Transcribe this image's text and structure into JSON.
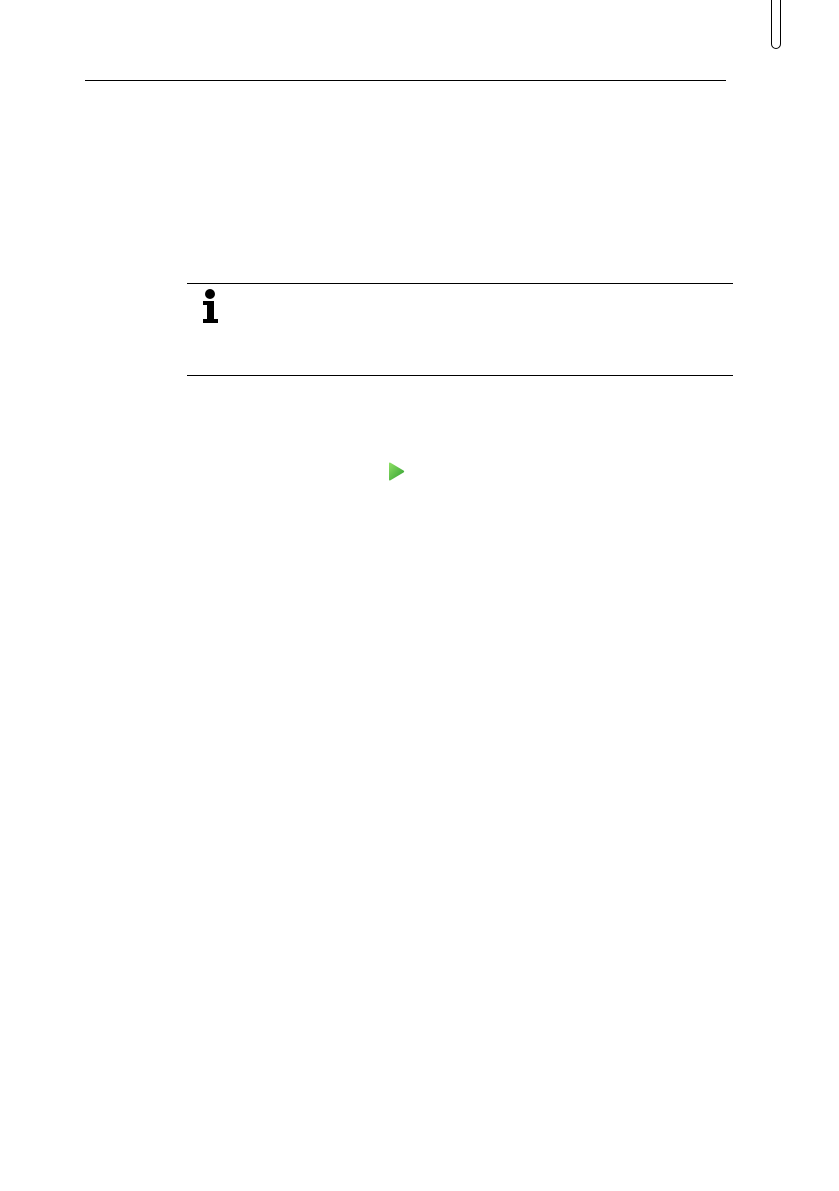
{
  "page": {
    "icons": {
      "info": "info-icon",
      "play": "play-triangle-icon"
    },
    "colors": {
      "rule": "#000000",
      "play_light": "#7ed957",
      "play_dark": "#2e9e2e"
    }
  }
}
